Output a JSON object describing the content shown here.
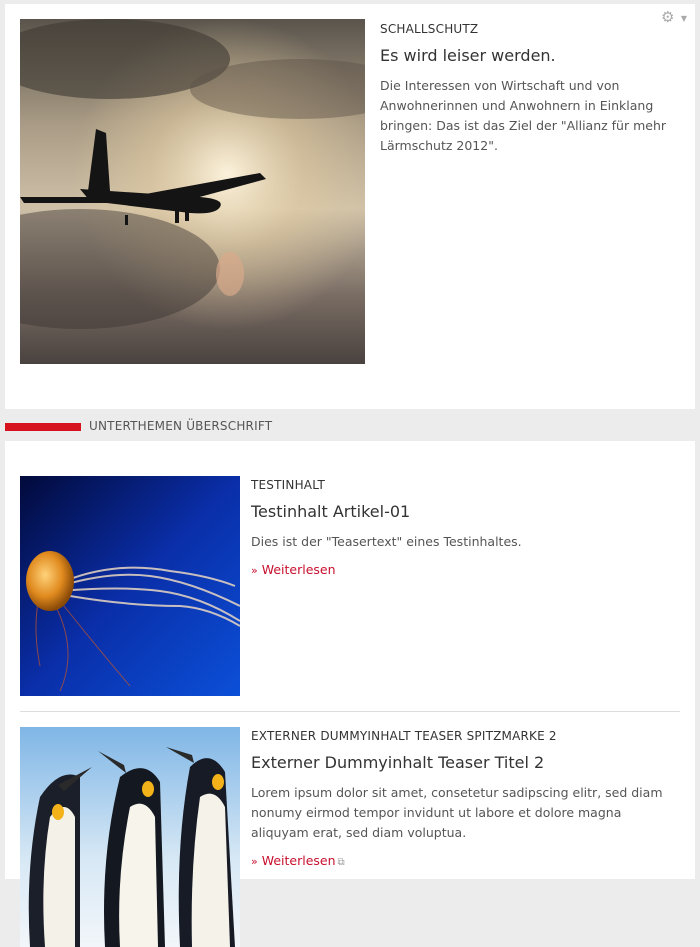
{
  "featured": {
    "kicker": "SCHALLSCHUTZ",
    "title": "Es wird leiser werden.",
    "teaser": "Die Interessen von Wirtschaft und von Anwohnerinnen und Anwohnern in Einklang bringen: Das ist das Ziel der \"Allianz für mehr Lärmschutz 2012\".",
    "settings_icon": "gear-icon"
  },
  "section": {
    "title": "UNTERTHEMEN ÜBERSCHRIFT",
    "accent_color": "#d7121f"
  },
  "items": [
    {
      "kicker": "TESTINHALT",
      "title": "Testinhalt Artikel-01",
      "teaser": "Dies ist der \"Teasertext\" eines Testinhaltes.",
      "more_label": "Weiterlesen",
      "more_arrow": "»"
    },
    {
      "kicker": "EXTERNER DUMMYINHALT TEASER SPITZMARKE 2",
      "title": "Externer Dummyinhalt Teaser Titel 2",
      "teaser": "Lorem ipsum dolor sit amet, consetetur sadipscing elitr, sed diam nonumy eirmod tempor invidunt ut labore et dolore magna aliquyam erat, sed diam voluptua.",
      "more_label": "Weiterlesen",
      "more_arrow": "»",
      "external_icon": "external-link-icon"
    }
  ],
  "colors": {
    "link": "#c8102e",
    "background": "#ececec",
    "card": "#ffffff"
  }
}
